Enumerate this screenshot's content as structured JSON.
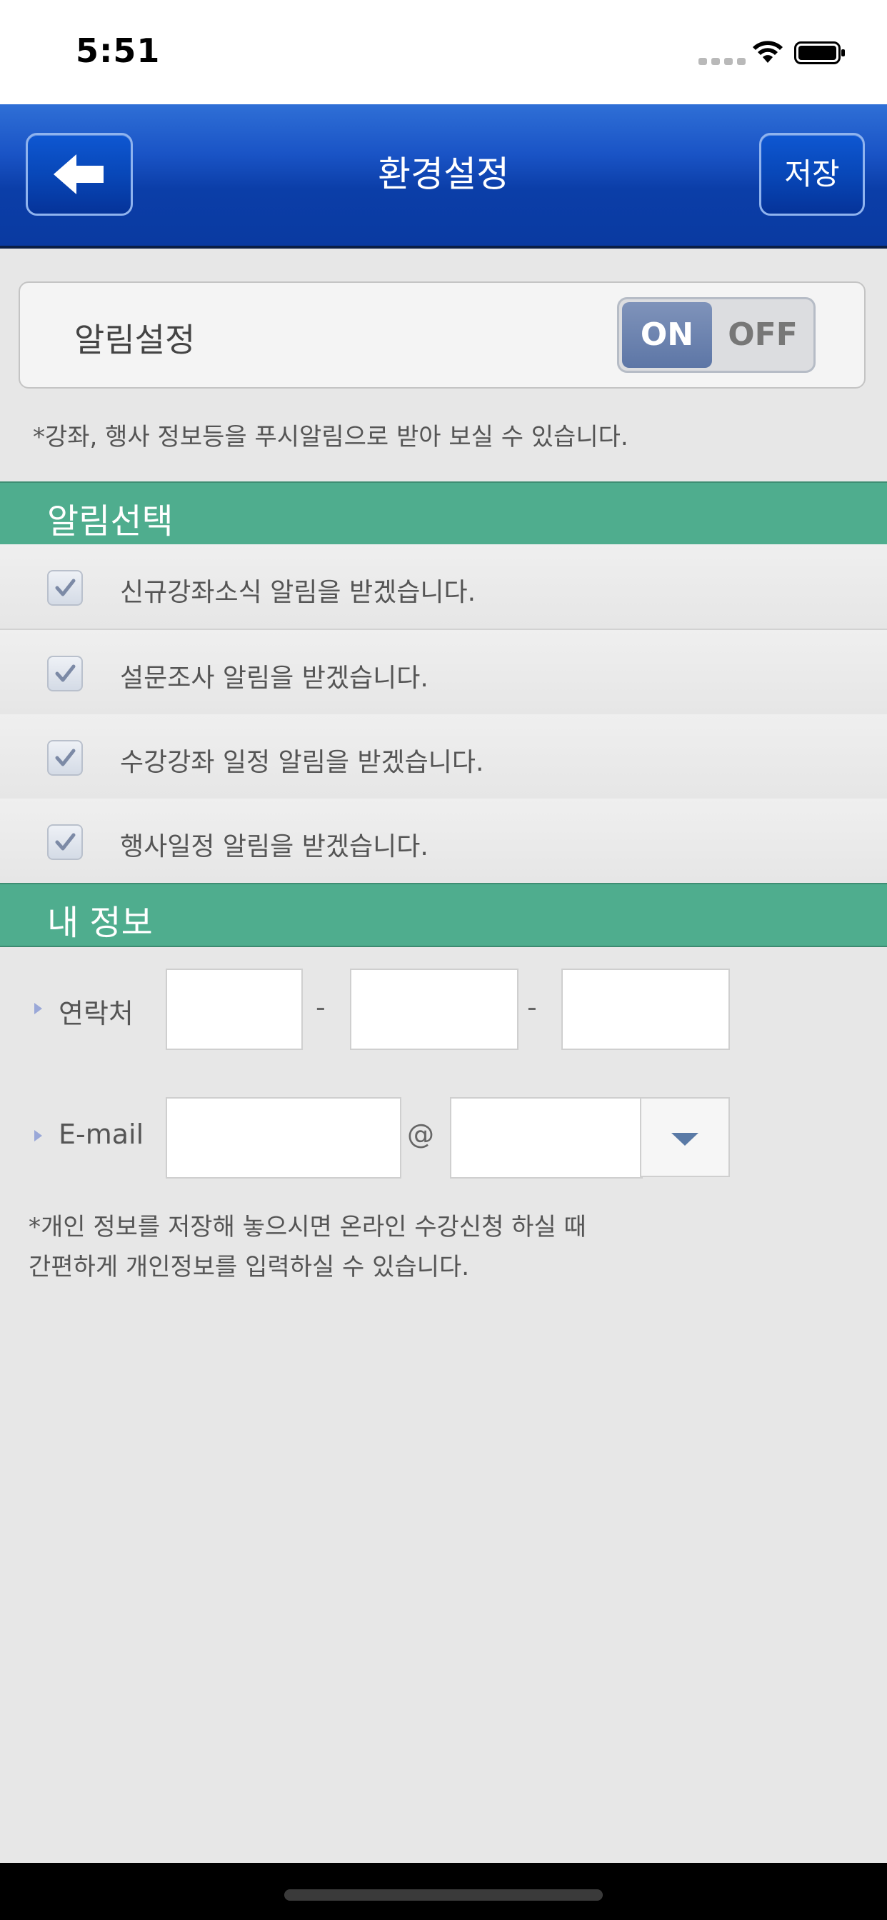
{
  "status_bar": {
    "time": "5:51"
  },
  "nav": {
    "title": "환경설정",
    "save_label": "저장"
  },
  "alarm": {
    "label": "알림설정",
    "toggle_on": "ON",
    "toggle_off": "OFF",
    "enabled": true,
    "note": "*강좌, 행사 정보등을 푸시알림으로 받아 보실 수 있습니다."
  },
  "alarm_select": {
    "title": "알림선택",
    "items": [
      {
        "label": "신규강좌소식 알림을 받겠습니다.",
        "checked": true
      },
      {
        "label": "설문조사 알림을 받겠습니다.",
        "checked": true
      },
      {
        "label": "수강강좌 일정 알림을 받겠습니다.",
        "checked": true
      },
      {
        "label": "행사일정 알림을 받겠습니다.",
        "checked": true
      }
    ]
  },
  "my_info": {
    "title": "내 정보",
    "phone_label": "연락처",
    "phone_sep": "-",
    "email_label": "E-mail",
    "email_at": "@",
    "note_line1": "*개인 정보를 저장해 놓으시면 온라인 수강신청 하실 때",
    "note_line2": "간편하게 개인정보를 입력하실 수 있습니다."
  },
  "colors": {
    "nav": "#0b3ea8",
    "section": "#4fad8e",
    "background": "#e7e7e7"
  }
}
